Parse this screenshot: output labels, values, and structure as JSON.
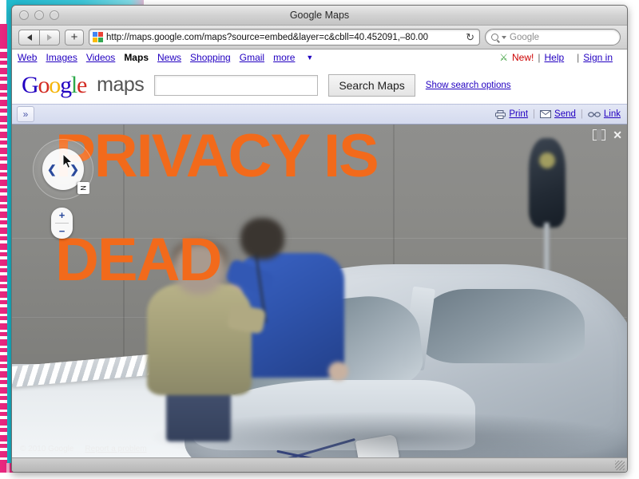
{
  "window": {
    "title": "Google Maps",
    "traffic_lights": [
      "close",
      "minimize",
      "zoom"
    ]
  },
  "browser": {
    "back_label": "◀",
    "forward_label": "▶",
    "add_tab_label": "+",
    "url": "http://maps.google.com/maps?source=embed&layer=c&cbll=40.452091,–80.00",
    "reload_label": "↻",
    "search_placeholder": "Google",
    "search_value": ""
  },
  "gnav": {
    "links": [
      "Web",
      "Images",
      "Videos",
      "News",
      "Shopping",
      "Gmail"
    ],
    "current": "Maps",
    "more_label": "more",
    "more_caret": "▼",
    "labs_icon": "flask-icon",
    "new_label": "New!",
    "help_label": "Help",
    "signin_label": "Sign in",
    "separator": "|"
  },
  "gheader": {
    "logo": {
      "g1": "G",
      "o1": "o",
      "o2": "o",
      "g2": "g",
      "l": "l",
      "e": "e"
    },
    "product": "maps",
    "search_value": "",
    "search_placeholder": "",
    "search_button": "Search Maps",
    "show_options": "Show search options"
  },
  "maptoolbar": {
    "expand_label": "»",
    "print_label": "Print",
    "send_label": "Send",
    "link_label": "Link",
    "print_icon": "printer-icon",
    "send_icon": "envelope-icon",
    "link_icon": "chain-link-icon",
    "divider": "|"
  },
  "streetview": {
    "pan_left": "❮",
    "pan_right": "❯",
    "north_label": "N",
    "zoom_in": "+",
    "zoom_out": "−",
    "fullscreen_icon": "fullscreen-icon",
    "close_icon": "close-icon",
    "copyright": "© 2010 Google",
    "report_problem": "Report a problem",
    "scene_description": "Street View photo of two people beside a silver sedan against a concrete wall, with a parking meter at right"
  },
  "overlay": {
    "line1": "PRIVACY IS",
    "line2": "DEAD",
    "color": "#F26A1B"
  },
  "colors": {
    "orange": "#F26A1B",
    "link_blue": "#2200C1",
    "cyan_accent": "#1FB8CF",
    "pink_accent": "#E8277F",
    "new_red": "#CC0000",
    "labs_green": "#3A9F3A"
  }
}
